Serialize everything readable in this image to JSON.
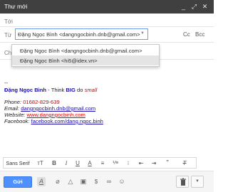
{
  "window": {
    "title": "Thư mới",
    "controls": [
      "minimize-icon",
      "expand-icon",
      "close-icon"
    ]
  },
  "compose": {
    "to_label": "Tới",
    "from_label": "Từ",
    "from_value": "Đặng Ngọc Bình <dangngocbinh.dnb@gmail.com>",
    "cc_label": "Cc",
    "bcc_label": "Bcc",
    "subject_label": "Chủ đề"
  },
  "from_dropdown": {
    "options": [
      "Đặng Ngọc Bình <dangngocbinh.dnb@gmail.com>",
      "Đặng Ngọc Bình <hi5@idex.vn>"
    ],
    "selected_index": 1
  },
  "signature": {
    "dashes": "--",
    "name": "Đặng Ngọc Bình",
    "slogan_sep": " - ",
    "slogan_think": "Think ",
    "slogan_big": "BIG",
    "slogan_do": " do ",
    "slogan_small": "small",
    "phone_label": "Phone: ",
    "phone_value": "01682-829-639",
    "email_label": "Email: ",
    "email_value": "dangngocbinh.dnb@gmail.com",
    "website_label": "Website: ",
    "website_value": "www.dangngocbinh.com",
    "facebook_label": "Facebook: ",
    "facebook_value": "facebook.com/dang.ngoc.binh"
  },
  "format_toolbar": {
    "font": "Sans Serif",
    "font_caret": "▾",
    "size_icon": "text-size-icon",
    "tools": [
      "bold-icon",
      "italic-icon",
      "underline-icon",
      "text-color-icon",
      "align-icon",
      "numbered-list-icon",
      "bulleted-list-icon",
      "indent-less-icon",
      "indent-more-icon",
      "quote-icon",
      "remove-formatting-icon"
    ]
  },
  "footer": {
    "send_label": "Gửi",
    "tools": [
      "formatting-icon",
      "attach-icon",
      "drive-icon",
      "insert-photo-icon",
      "money-icon",
      "link-icon",
      "emoji-icon"
    ]
  },
  "colors": {
    "titlebar": "#404040",
    "send": "#4d90fe",
    "link": "#1a0dab",
    "signature_blue": "#1a0dab",
    "signature_red": "#e00000",
    "phone": "#cc0000"
  }
}
